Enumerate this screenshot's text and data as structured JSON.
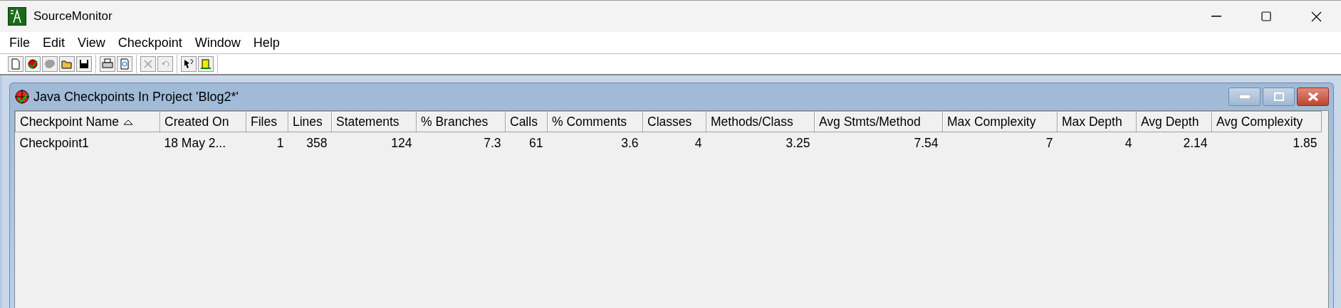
{
  "window": {
    "title": "SourceMonitor"
  },
  "menu": [
    "File",
    "Edit",
    "View",
    "Checkpoint",
    "Window",
    "Help"
  ],
  "toolbar": [
    [
      {
        "kind": "new",
        "disabled": false
      },
      {
        "kind": "target",
        "disabled": false
      },
      {
        "kind": "blob",
        "disabled": true
      },
      {
        "kind": "open",
        "disabled": false
      },
      {
        "kind": "save",
        "disabled": false
      }
    ],
    [
      {
        "kind": "print",
        "disabled": false
      },
      {
        "kind": "preview",
        "disabled": false
      }
    ],
    [
      {
        "kind": "cut",
        "disabled": true
      },
      {
        "kind": "undo",
        "disabled": true
      }
    ],
    [
      {
        "kind": "help",
        "disabled": false
      },
      {
        "kind": "exit",
        "disabled": false
      }
    ]
  ],
  "child_window": {
    "title": "Java Checkpoints In Project 'Blog2*'",
    "table": {
      "columns": [
        {
          "label": "Checkpoint Name",
          "sorted": true,
          "kind": "text"
        },
        {
          "label": "Created On",
          "sorted": false,
          "kind": "text"
        },
        {
          "label": "Files",
          "sorted": false,
          "kind": "number"
        },
        {
          "label": "Lines",
          "sorted": false,
          "kind": "number"
        },
        {
          "label": "Statements",
          "sorted": false,
          "kind": "number"
        },
        {
          "label": "% Branches",
          "sorted": false,
          "kind": "number"
        },
        {
          "label": "Calls",
          "sorted": false,
          "kind": "number"
        },
        {
          "label": "% Comments",
          "sorted": false,
          "kind": "number"
        },
        {
          "label": "Classes",
          "sorted": false,
          "kind": "number"
        },
        {
          "label": "Methods/Class",
          "sorted": false,
          "kind": "number"
        },
        {
          "label": "Avg Stmts/Method",
          "sorted": false,
          "kind": "number"
        },
        {
          "label": "Max Complexity",
          "sorted": false,
          "kind": "number"
        },
        {
          "label": "Max Depth",
          "sorted": false,
          "kind": "number"
        },
        {
          "label": "Avg Depth",
          "sorted": false,
          "kind": "number"
        },
        {
          "label": "Avg Complexity",
          "sorted": false,
          "kind": "number"
        }
      ],
      "rows": [
        [
          "Checkpoint1",
          "18 May 2...",
          "1",
          "358",
          "124",
          "7.3",
          "61",
          "3.6",
          "4",
          "3.25",
          "7.54",
          "7",
          "4",
          "2.14",
          "1.85"
        ]
      ]
    }
  }
}
